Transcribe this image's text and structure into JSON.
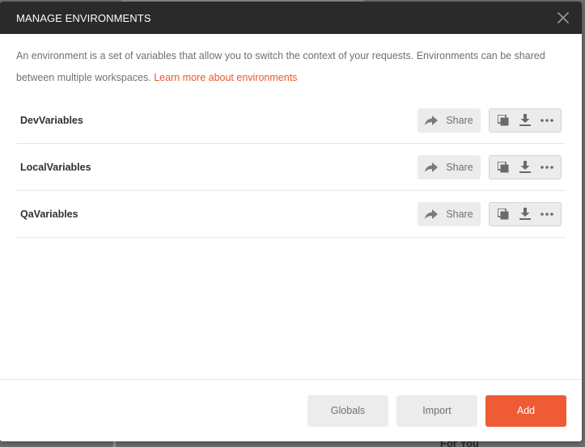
{
  "modal": {
    "title": "MANAGE ENVIRONMENTS",
    "description": "An environment is a set of variables that allow you to switch the context of your requests. Environments can be shared between multiple workspaces.",
    "learn_more_link": "Learn more about environments"
  },
  "environments": [
    {
      "name": "DevVariables",
      "share_label": "Share"
    },
    {
      "name": "LocalVariables",
      "share_label": "Share"
    },
    {
      "name": "QaVariables",
      "share_label": "Share"
    }
  ],
  "icons": {
    "close": "close-icon",
    "share": "share-arrow-icon",
    "duplicate": "duplicate-icon",
    "download": "download-icon",
    "more": "more-icon"
  },
  "footer": {
    "globals_label": "Globals",
    "import_label": "Import",
    "add_label": "Add"
  },
  "background": {
    "for_you_text": "For You"
  },
  "colors": {
    "header_bg": "#2a2a2a",
    "accent": "#ef5b34",
    "link": "#e8582d",
    "button_bg": "#ececec"
  }
}
